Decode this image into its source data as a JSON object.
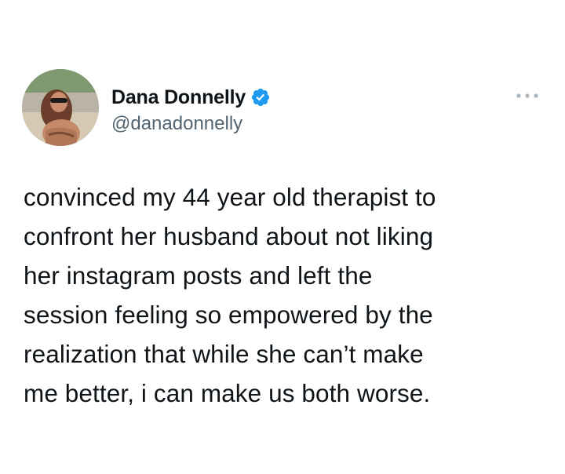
{
  "author": {
    "display_name": "Dana Donnelly",
    "handle": "@danadonnelly",
    "verified": true,
    "verified_icon": "verified-badge-icon",
    "verified_color": "#1d9bf0"
  },
  "actions": {
    "more_icon": "more-horizontal-icon"
  },
  "tweet": {
    "text": "convinced my 44 year old therapist to\nconfront her husband about not liking\nher instagram posts and left the\nsession feeling so empowered by the\nrealization that while she can’t make\nme better, i can make us both worse."
  },
  "colors": {
    "text": "#0f1419",
    "secondary": "#536471",
    "background": "#ffffff"
  }
}
